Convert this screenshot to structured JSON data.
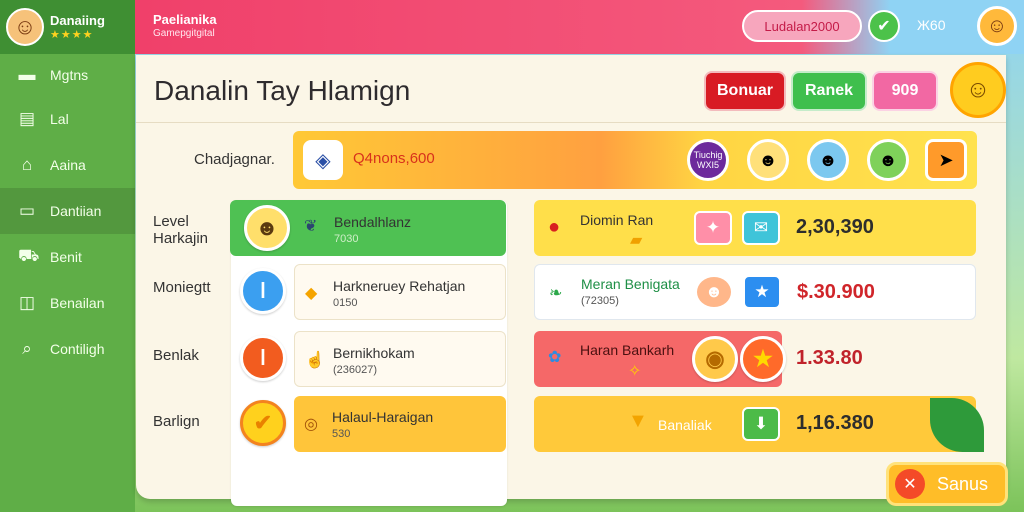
{
  "sidebar": {
    "brand": "Danaiing",
    "stars": "★★★★",
    "items": [
      {
        "label": "Mgtns",
        "icon": "building-icon"
      },
      {
        "label": "Lal",
        "icon": "document-icon"
      },
      {
        "label": "Aaina",
        "icon": "home-icon"
      },
      {
        "label": "Dantiian",
        "icon": "card-icon"
      },
      {
        "label": "Benit",
        "icon": "cart-icon"
      },
      {
        "label": "Benailan",
        "icon": "chart-icon"
      },
      {
        "label": "Contiligh",
        "icon": "search-icon"
      }
    ]
  },
  "topbar": {
    "title": "Paelianika",
    "subtitle": "Gamepgitgital",
    "coins": "Ludalan2000",
    "count": "Ж60",
    "colors": {
      "accent": "#f0406a",
      "green": "#4cc24a"
    }
  },
  "panel": {
    "title": "Danalin Tay Hlamign",
    "tabs": [
      {
        "label": "Bonuar",
        "color": "#d81b24"
      },
      {
        "label": "Ranek",
        "color": "#3fbf4d"
      },
      {
        "label": "909",
        "color": "#f268a3"
      }
    ]
  },
  "banner": {
    "label": "Chadjagnar.",
    "value": "Q4nons,600",
    "badge": "Tiuchig WXI5"
  },
  "rows": [
    {
      "label": "Level Harkajin",
      "left": {
        "title": "Bendalhlanz",
        "sub": "7030"
      },
      "right": {
        "title": "Diomin Ran",
        "value": "2,30,390"
      }
    },
    {
      "label": "Moniegtt",
      "left": {
        "title": "Harkneruey Rehatjan",
        "sub": "0150"
      },
      "right": {
        "title": "Meran Benigata",
        "sub": "(72305)",
        "value": "$.30.900"
      }
    },
    {
      "label": "Benlak",
      "left": {
        "title": "Bernikhokam",
        "sub": "(236027)"
      },
      "right": {
        "title": "Haran Bankarh",
        "value": "1.33.80"
      }
    },
    {
      "label": "Barlign",
      "left": {
        "title": "Halaul-Haraigan",
        "sub": "530"
      },
      "right": {
        "title": "Banaliak",
        "value": "1,16.380"
      }
    }
  ],
  "bottom_button": "Sanus"
}
